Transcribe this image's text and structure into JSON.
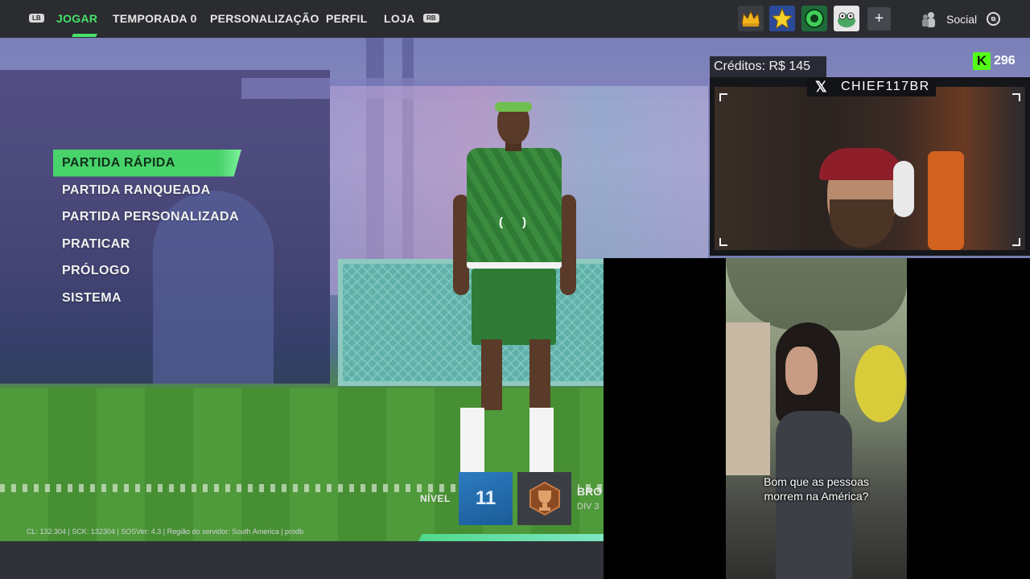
{
  "topbar": {
    "lb_label": "LB",
    "rb_label": "RB",
    "nav": [
      {
        "label": "JOGAR",
        "active": true
      },
      {
        "label": "TEMPORADA 0"
      },
      {
        "label": "PERSONALIZAÇÃO"
      },
      {
        "label": "PERFIL"
      },
      {
        "label": "LOJA"
      }
    ],
    "badges": [
      "crown-badge-icon",
      "star-badge-icon",
      "ball-badge-icon",
      "creature-badge-icon"
    ],
    "add_label": "+",
    "social_label": "Social",
    "social_button": "⧉"
  },
  "menu": {
    "items": [
      {
        "label": "PARTIDA RÁPIDA",
        "selected": true
      },
      {
        "label": "PARTIDA RANQUEADA"
      },
      {
        "label": "PARTIDA PERSONALIZADA"
      },
      {
        "label": "PRATICAR"
      },
      {
        "label": "PRÓLOGO"
      },
      {
        "label": "SISTEMA"
      }
    ]
  },
  "profile": {
    "level_label": "NÍVEL",
    "level_value": "11",
    "rank_label": "BRO",
    "rank_division": "DIV 3"
  },
  "server_info": "CL: 132.304 | SCK: 132304 | SOSVer: 4.3 | Região do servidor: South America | prodb",
  "overlay": {
    "credits": "Créditos: R$ 145",
    "kick_icon": "K",
    "kick_count": "296",
    "streamer_handle": "CHIEF117BR",
    "x_icon": "𝕏",
    "video_subtitle_line1": "Bom que as pessoas",
    "video_subtitle_line2": "morrem na América?"
  },
  "colors": {
    "accent": "#46e26a",
    "topbar_bg": "#2a2c30",
    "level_blue": "#2c7bbf",
    "kick_green": "#53fc18"
  }
}
